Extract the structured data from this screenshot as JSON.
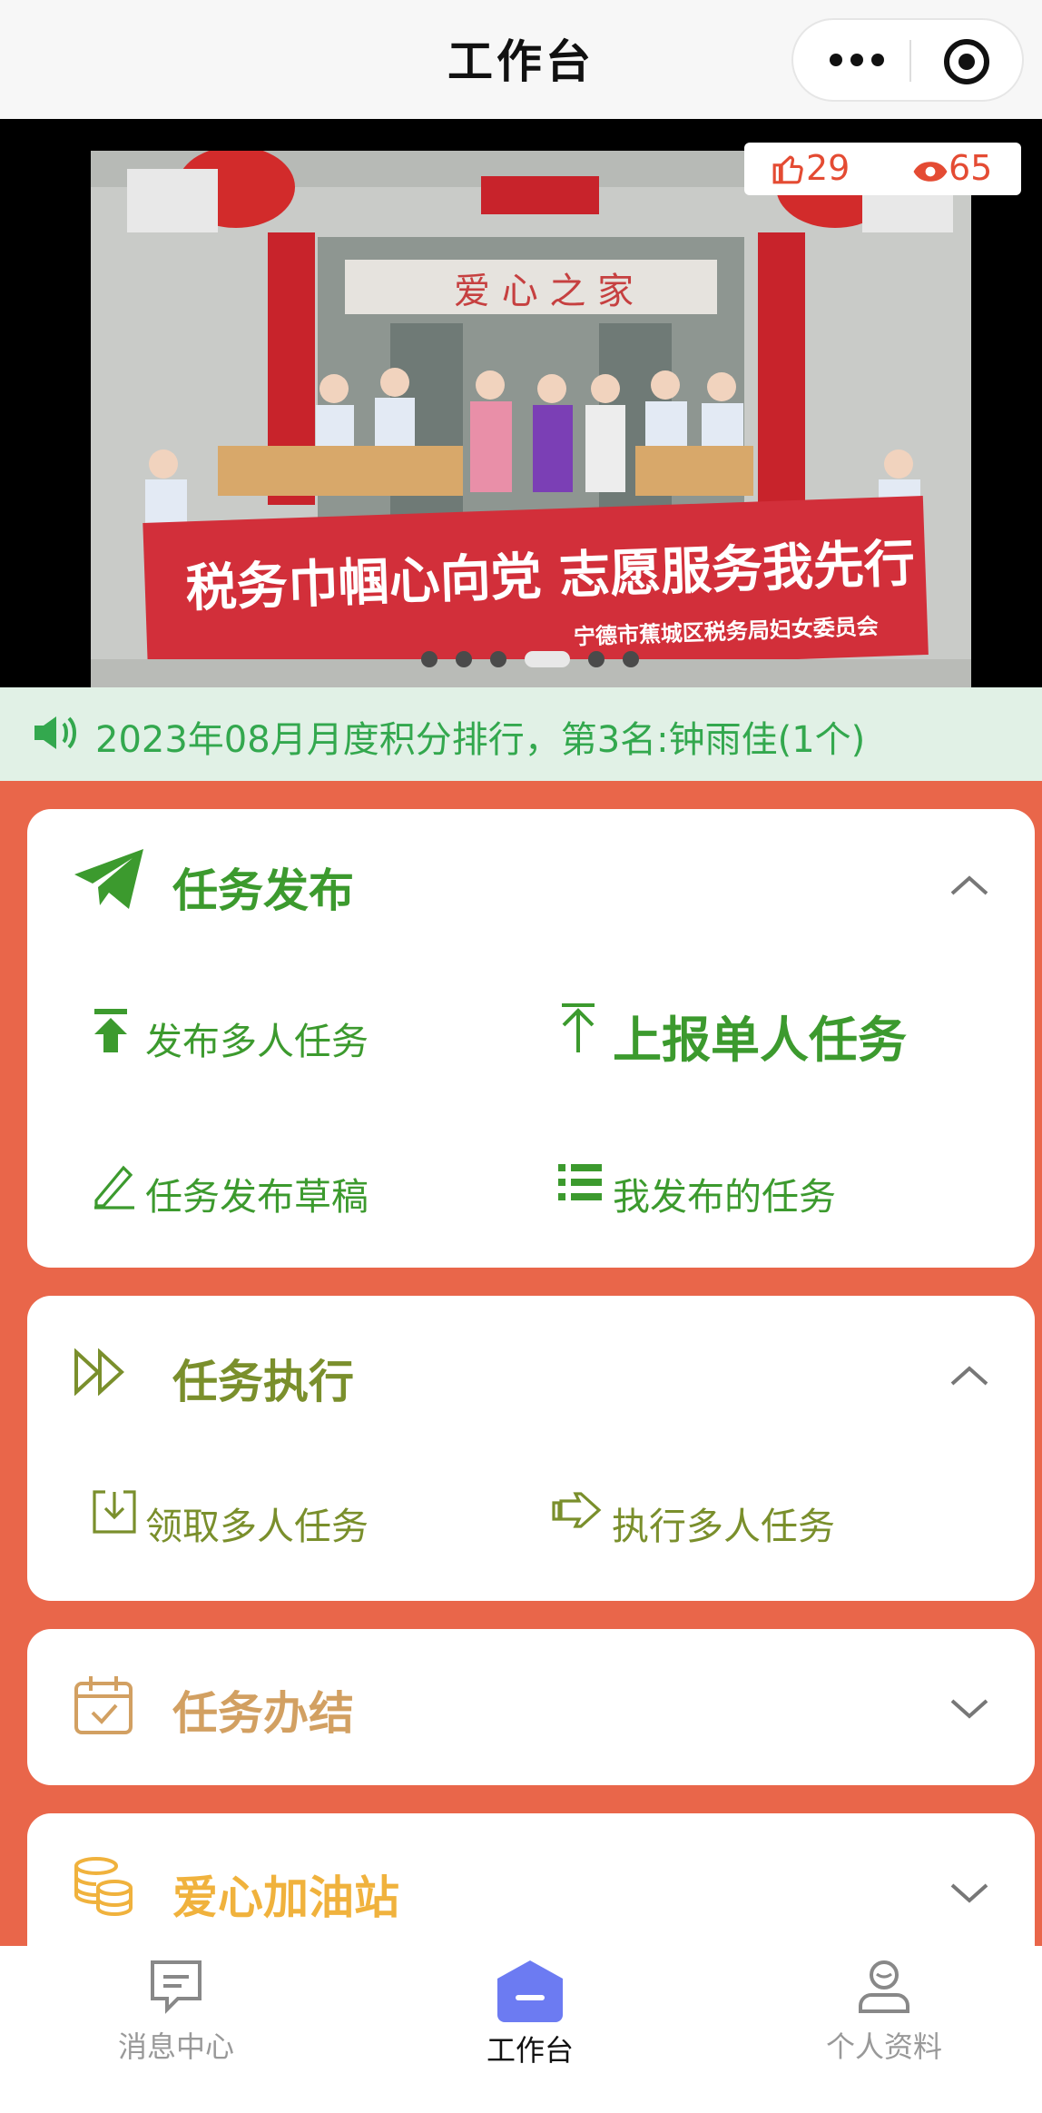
{
  "header": {
    "title": "工作台"
  },
  "banner": {
    "banner_text_main": "税务巾帼心向党  志愿服务我先行",
    "banner_text_sub": "宁德市蕉城区税务局妇女委员会",
    "likes": "29",
    "views": "65",
    "slide_count": 6,
    "active_slide": 3
  },
  "notice": {
    "text": "2023年08月月度积分排行，第3名:钟雨佳(1个)"
  },
  "sections": {
    "publish": {
      "title": "任务发布",
      "items": [
        "发布多人任务",
        "上报单人任务",
        "任务发布草稿",
        "我发布的任务"
      ]
    },
    "execute": {
      "title": "任务执行",
      "items": [
        "领取多人任务",
        "执行多人任务"
      ]
    },
    "complete": {
      "title": "任务办结"
    },
    "refuel": {
      "title": "爱心加油站"
    }
  },
  "tabbar": {
    "items": [
      "消息中心",
      "工作台",
      "个人资料"
    ],
    "active": "工作台"
  },
  "colors": {
    "page_bg": "#E9664A",
    "green": "#3C9A2E",
    "olive": "#7A8F2C",
    "tan": "#D2A062",
    "gold": "#F0B23D",
    "accent_blue": "#6C7BF2",
    "notice_text": "#33A84E"
  }
}
